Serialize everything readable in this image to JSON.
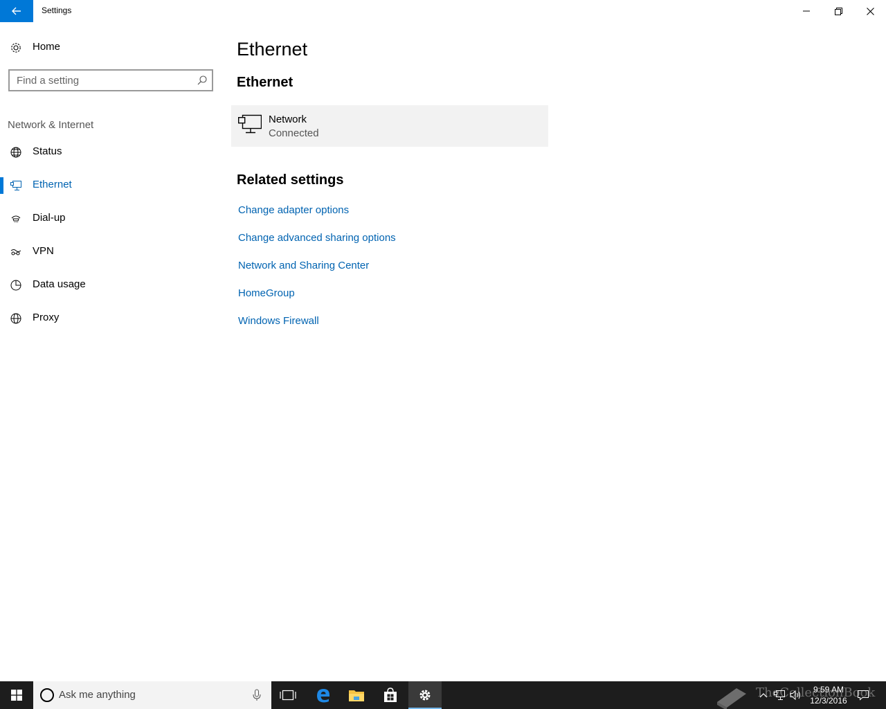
{
  "window": {
    "title": "Settings"
  },
  "sidebar": {
    "home_label": "Home",
    "search_placeholder": "Find a setting",
    "section_title": "Network & Internet",
    "items": [
      {
        "label": "Status",
        "icon": "globe-status-icon"
      },
      {
        "label": "Ethernet",
        "icon": "ethernet-icon",
        "active": true
      },
      {
        "label": "Dial-up",
        "icon": "dialup-icon"
      },
      {
        "label": "VPN",
        "icon": "vpn-icon"
      },
      {
        "label": "Data usage",
        "icon": "data-usage-icon"
      },
      {
        "label": "Proxy",
        "icon": "globe-icon"
      }
    ]
  },
  "main": {
    "page_title": "Ethernet",
    "section_title": "Ethernet",
    "network": {
      "name": "Network",
      "status": "Connected"
    },
    "related_title": "Related settings",
    "links": [
      "Change adapter options",
      "Change advanced sharing options",
      "Network and Sharing Center",
      "HomeGroup",
      "Windows Firewall"
    ]
  },
  "taskbar": {
    "search_placeholder": "Ask me anything",
    "time": "9:59 AM",
    "date": "12/3/2016",
    "watermark": "TheCollectionBook"
  },
  "colors": {
    "accent": "#0078d7",
    "link": "#0063b1",
    "taskbar": "#1d1d1d",
    "tile": "#f2f2f2"
  }
}
